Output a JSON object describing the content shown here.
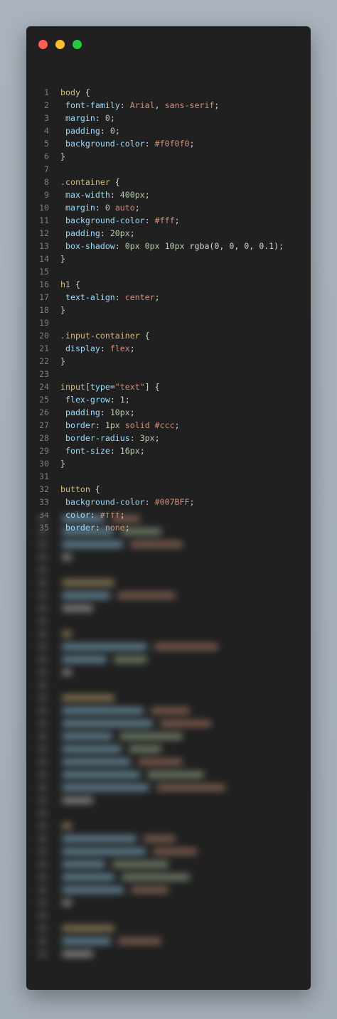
{
  "window": {
    "controls": [
      {
        "name": "close",
        "color": "#ff5f56"
      },
      {
        "name": "minimize",
        "color": "#ffbd2e"
      },
      {
        "name": "maximize",
        "color": "#27c93f"
      }
    ]
  },
  "code_lines": [
    {
      "n": "1",
      "tokens": [
        [
          "sel",
          "body"
        ],
        [
          "punc",
          " {"
        ]
      ]
    },
    {
      "n": "2",
      "tokens": [
        [
          "punc",
          " "
        ],
        [
          "prop",
          "font-family"
        ],
        [
          "punc",
          ": "
        ],
        [
          "val",
          "Arial"
        ],
        [
          "punc",
          ", "
        ],
        [
          "val",
          "sans-serif"
        ],
        [
          "punc",
          ";"
        ]
      ]
    },
    {
      "n": "3",
      "tokens": [
        [
          "punc",
          " "
        ],
        [
          "prop",
          "margin"
        ],
        [
          "punc",
          ": "
        ],
        [
          "num",
          "0"
        ],
        [
          "punc",
          ";"
        ]
      ]
    },
    {
      "n": "4",
      "tokens": [
        [
          "punc",
          " "
        ],
        [
          "prop",
          "padding"
        ],
        [
          "punc",
          ": "
        ],
        [
          "num",
          "0"
        ],
        [
          "punc",
          ";"
        ]
      ]
    },
    {
      "n": "5",
      "tokens": [
        [
          "punc",
          " "
        ],
        [
          "prop",
          "background-color"
        ],
        [
          "punc",
          ": "
        ],
        [
          "val",
          "#f0f0f0"
        ],
        [
          "punc",
          ";"
        ]
      ]
    },
    {
      "n": "6",
      "tokens": [
        [
          "punc",
          "}"
        ]
      ]
    },
    {
      "n": "7",
      "tokens": []
    },
    {
      "n": "8",
      "tokens": [
        [
          "sel",
          ".container"
        ],
        [
          "punc",
          " {"
        ]
      ]
    },
    {
      "n": "9",
      "tokens": [
        [
          "punc",
          " "
        ],
        [
          "prop",
          "max-width"
        ],
        [
          "punc",
          ": "
        ],
        [
          "num",
          "400px"
        ],
        [
          "punc",
          ";"
        ]
      ]
    },
    {
      "n": "10",
      "tokens": [
        [
          "punc",
          " "
        ],
        [
          "prop",
          "margin"
        ],
        [
          "punc",
          ": "
        ],
        [
          "num",
          "0"
        ],
        [
          "punc",
          " "
        ],
        [
          "val",
          "auto"
        ],
        [
          "punc",
          ";"
        ]
      ]
    },
    {
      "n": "11",
      "tokens": [
        [
          "punc",
          " "
        ],
        [
          "prop",
          "background-color"
        ],
        [
          "punc",
          ": "
        ],
        [
          "val",
          "#fff"
        ],
        [
          "punc",
          ";"
        ]
      ]
    },
    {
      "n": "12",
      "tokens": [
        [
          "punc",
          " "
        ],
        [
          "prop",
          "padding"
        ],
        [
          "punc",
          ": "
        ],
        [
          "num",
          "20px"
        ],
        [
          "punc",
          ";"
        ]
      ]
    },
    {
      "n": "13",
      "tokens": [
        [
          "punc",
          " "
        ],
        [
          "prop",
          "box-shadow"
        ],
        [
          "punc",
          ": "
        ],
        [
          "num",
          "0px 0px 10px "
        ],
        [
          "punc",
          "rgba(0, 0, 0, 0.1);"
        ]
      ]
    },
    {
      "n": "14",
      "tokens": [
        [
          "punc",
          "}"
        ]
      ]
    },
    {
      "n": "15",
      "tokens": []
    },
    {
      "n": "16",
      "tokens": [
        [
          "sel",
          "h1"
        ],
        [
          "punc",
          " {"
        ]
      ]
    },
    {
      "n": "17",
      "tokens": [
        [
          "punc",
          " "
        ],
        [
          "prop",
          "text-align"
        ],
        [
          "punc",
          ": "
        ],
        [
          "val",
          "center"
        ],
        [
          "punc",
          ";"
        ]
      ]
    },
    {
      "n": "18",
      "tokens": [
        [
          "punc",
          "}"
        ]
      ]
    },
    {
      "n": "19",
      "tokens": []
    },
    {
      "n": "20",
      "tokens": [
        [
          "sel",
          ".input-container"
        ],
        [
          "punc",
          " {"
        ]
      ]
    },
    {
      "n": "21",
      "tokens": [
        [
          "punc",
          " "
        ],
        [
          "prop",
          "display"
        ],
        [
          "punc",
          ": "
        ],
        [
          "val",
          "flex"
        ],
        [
          "punc",
          ";"
        ]
      ]
    },
    {
      "n": "22",
      "tokens": [
        [
          "punc",
          "}"
        ]
      ]
    },
    {
      "n": "23",
      "tokens": []
    },
    {
      "n": "24",
      "tokens": [
        [
          "sel",
          "input"
        ],
        [
          "punc",
          "["
        ],
        [
          "prop",
          "type"
        ],
        [
          "punc",
          "="
        ],
        [
          "str",
          "\"text\""
        ],
        [
          "punc",
          "] {"
        ]
      ]
    },
    {
      "n": "25",
      "tokens": [
        [
          "punc",
          " "
        ],
        [
          "prop",
          "flex-grow"
        ],
        [
          "punc",
          ": "
        ],
        [
          "num",
          "1"
        ],
        [
          "punc",
          ";"
        ]
      ]
    },
    {
      "n": "26",
      "tokens": [
        [
          "punc",
          " "
        ],
        [
          "prop",
          "padding"
        ],
        [
          "punc",
          ": "
        ],
        [
          "num",
          "10px"
        ],
        [
          "punc",
          ";"
        ]
      ]
    },
    {
      "n": "27",
      "tokens": [
        [
          "punc",
          " "
        ],
        [
          "prop",
          "border"
        ],
        [
          "punc",
          ": "
        ],
        [
          "num",
          "1px"
        ],
        [
          "punc",
          " "
        ],
        [
          "val",
          "solid #ccc"
        ],
        [
          "punc",
          ";"
        ]
      ]
    },
    {
      "n": "28",
      "tokens": [
        [
          "punc",
          " "
        ],
        [
          "prop",
          "border-radius"
        ],
        [
          "punc",
          ": "
        ],
        [
          "num",
          "3px"
        ],
        [
          "punc",
          ";"
        ]
      ]
    },
    {
      "n": "29",
      "tokens": [
        [
          "punc",
          " "
        ],
        [
          "prop",
          "font-size"
        ],
        [
          "punc",
          ": "
        ],
        [
          "num",
          "16px"
        ],
        [
          "punc",
          ";"
        ]
      ]
    },
    {
      "n": "30",
      "tokens": [
        [
          "punc",
          "}"
        ]
      ]
    },
    {
      "n": "31",
      "tokens": []
    },
    {
      "n": "32",
      "tokens": [
        [
          "sel",
          "button"
        ],
        [
          "punc",
          " {"
        ]
      ]
    },
    {
      "n": "33",
      "tokens": [
        [
          "punc",
          " "
        ],
        [
          "prop",
          "background-color"
        ],
        [
          "punc",
          ": "
        ],
        [
          "val",
          "#007BFF"
        ],
        [
          "punc",
          ";"
        ]
      ]
    },
    {
      "n": "34",
      "tokens": [
        [
          "punc",
          " "
        ],
        [
          "prop",
          "color"
        ],
        [
          "punc",
          ": "
        ],
        [
          "val",
          "#fff"
        ],
        [
          "punc",
          ";"
        ]
      ]
    },
    {
      "n": "35",
      "tokens": [
        [
          "punc",
          " "
        ],
        [
          "prop",
          "border"
        ],
        [
          "punc",
          ": "
        ],
        [
          "val",
          "none"
        ],
        [
          "punc",
          ";"
        ]
      ]
    }
  ],
  "blurred_region": {
    "lines": [
      [
        "#9cdcfe",
        "#ce9178"
      ],
      [
        "#9cdcfe",
        "#b5cea8"
      ],
      [
        "#9cdcfe",
        "#ce9178"
      ],
      [
        "#d4d4d4"
      ],
      [],
      [
        "#d7ba7d"
      ],
      [
        "#9cdcfe",
        "#ce9178"
      ],
      [
        "#d4d4d4"
      ],
      [],
      [
        "#d7ba7d"
      ],
      [
        "#9cdcfe",
        "#ce9178"
      ],
      [
        "#9cdcfe",
        "#b5cea8"
      ],
      [
        "#d4d4d4"
      ],
      [],
      [
        "#d7ba7d"
      ],
      [
        "#9cdcfe",
        "#ce9178"
      ],
      [
        "#9cdcfe",
        "#ce9178"
      ],
      [
        "#9cdcfe",
        "#b5cea8"
      ],
      [
        "#9cdcfe",
        "#b5cea8"
      ],
      [
        "#9cdcfe",
        "#ce9178"
      ],
      [
        "#9cdcfe",
        "#b5cea8"
      ],
      [
        "#9cdcfe",
        "#ce9178"
      ],
      [
        "#d4d4d4"
      ],
      [],
      [
        "#d7ba7d"
      ],
      [
        "#9cdcfe",
        "#ce9178"
      ],
      [
        "#9cdcfe",
        "#ce9178"
      ],
      [
        "#9cdcfe",
        "#b5cea8"
      ],
      [
        "#9cdcfe",
        "#b5cea8"
      ],
      [
        "#9cdcfe",
        "#ce9178"
      ],
      [
        "#d4d4d4"
      ],
      [],
      [
        "#d7ba7d"
      ],
      [
        "#9cdcfe",
        "#ce9178"
      ],
      [
        "#d4d4d4"
      ]
    ]
  }
}
